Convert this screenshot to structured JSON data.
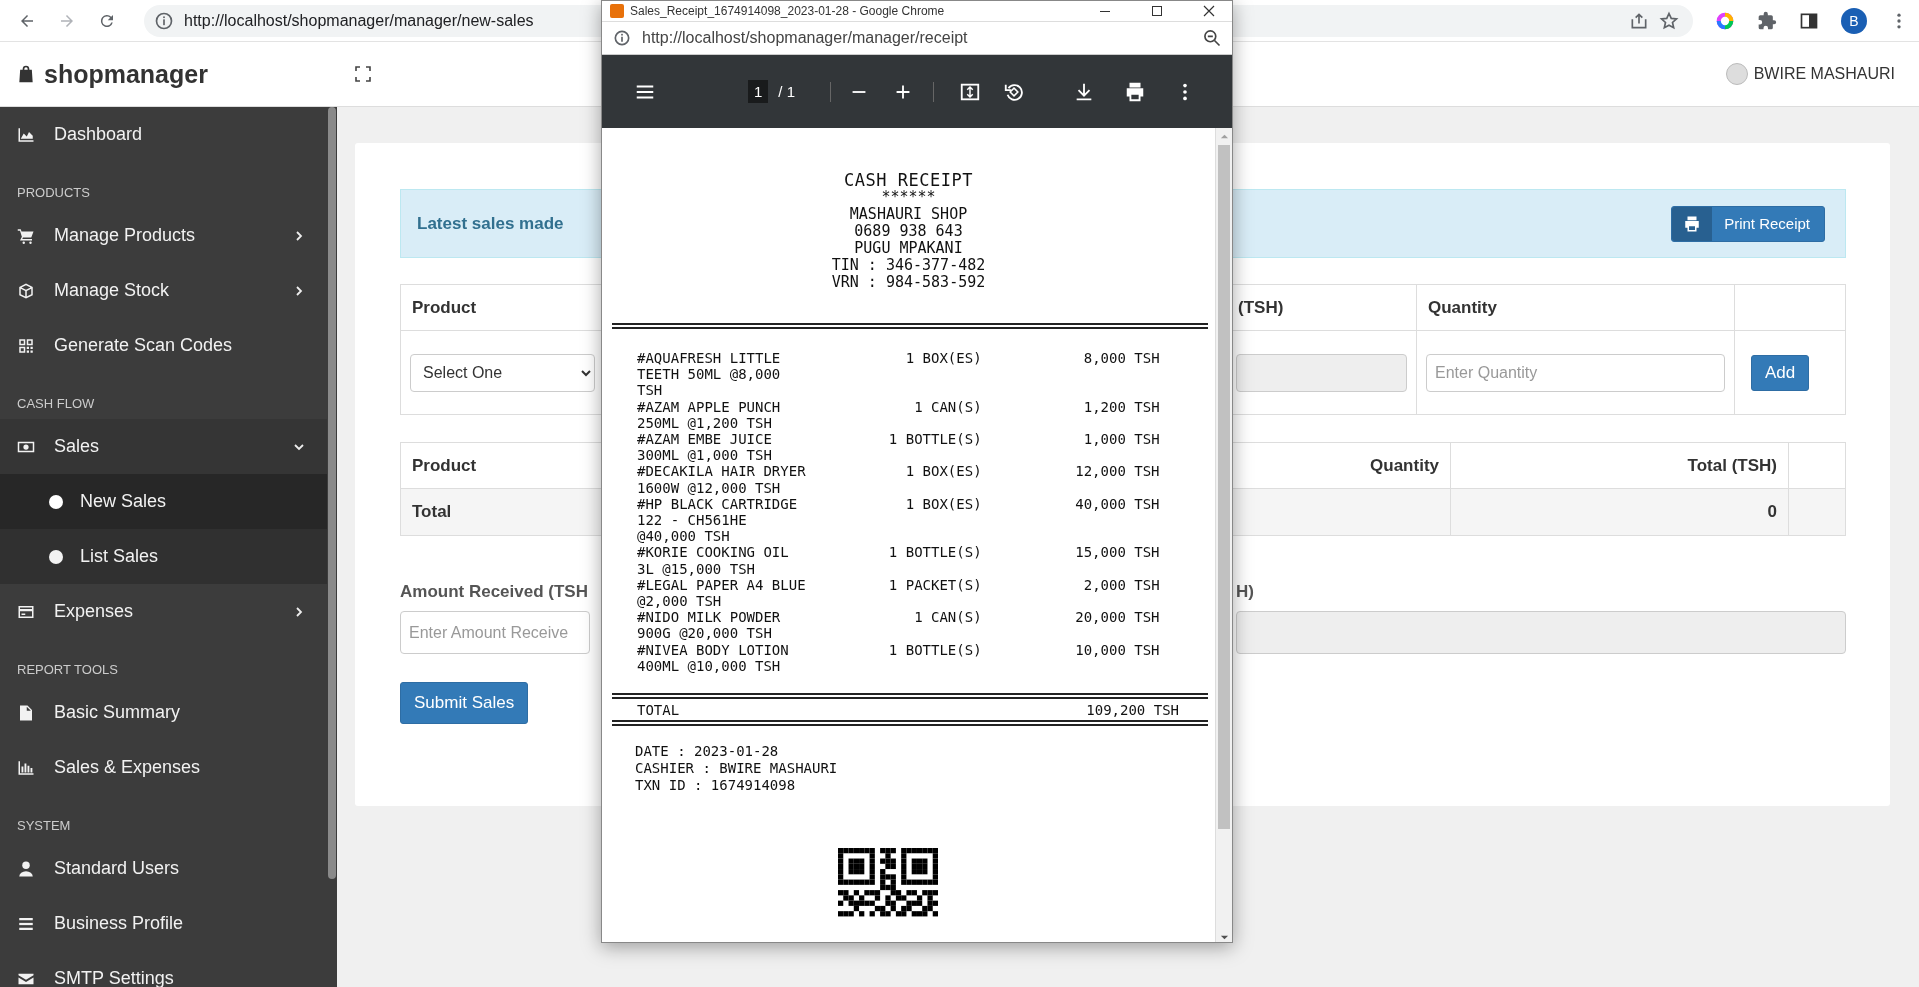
{
  "browser": {
    "url": "http://localhost/shopmanager/manager/new-sales",
    "profile_initial": "B"
  },
  "app_header": {
    "brand": "shopmanager",
    "user": "BWIRE MASHAURI"
  },
  "sidebar": {
    "groups": [
      {
        "items": [
          {
            "label": "Dashboard",
            "selected": false
          }
        ]
      },
      {
        "heading": "PRODUCTS",
        "items": [
          {
            "label": "Manage Products",
            "selected": false,
            "expanded": false
          },
          {
            "label": "Manage Stock",
            "selected": false,
            "expanded": false
          },
          {
            "label": "Generate Scan Codes",
            "selected": false
          }
        ]
      },
      {
        "heading": "CASH FLOW",
        "items": [
          {
            "label": "Sales",
            "selected": false,
            "expanded": true,
            "children": [
              {
                "label": "New Sales",
                "selected": true
              },
              {
                "label": "List Sales",
                "selected": false
              }
            ]
          },
          {
            "label": "Expenses",
            "selected": false,
            "expanded": false
          }
        ]
      },
      {
        "heading": "REPORT TOOLS",
        "items": [
          {
            "label": "Basic Summary",
            "selected": false
          },
          {
            "label": "Sales & Expenses",
            "selected": false
          }
        ]
      },
      {
        "heading": "SYSTEM",
        "items": [
          {
            "label": "Standard Users",
            "selected": false
          },
          {
            "label": "Business Profile",
            "selected": false
          },
          {
            "label": "SMTP Settings",
            "selected": false
          }
        ]
      }
    ]
  },
  "sales_form": {
    "alert": {
      "text": "Latest sales made",
      "button": "Print Receipt"
    },
    "entry_table": {
      "columns": [
        "Product",
        "(TSH)",
        "Quantity"
      ],
      "product_select": {
        "value": "Select One"
      },
      "price_field": {
        "disabled": true
      },
      "quantity_field": {
        "placeholder": "Enter Quantity"
      },
      "add_button": "Add"
    },
    "sales_table": {
      "columns": [
        "Product",
        "Quantity",
        "Total (TSH)"
      ],
      "total_row": {
        "label": "Total",
        "total": "0"
      }
    },
    "amount_received": {
      "label": "Amount Received (TSH",
      "placeholder": "Enter Amount Receive"
    },
    "change": {
      "label": "H)",
      "disabled": true
    },
    "submit_button": "Submit Sales"
  },
  "receipt_window": {
    "title": "Sales_Receipt_1674914098_2023-01-28 - Google Chrome",
    "url": "http://localhost/shopmanager/manager/receipt",
    "pdf_toolbar": {
      "page": "1",
      "page_count": "/ 1"
    },
    "receipt": {
      "title": "CASH RECEIPT",
      "title_mark": "******",
      "header_lines": [
        "MASHAURI SHOP",
        "0689 938 643",
        "PUGU MPAKANI",
        "TIN : 346-377-482",
        "VRN : 984-583-592"
      ],
      "items": [
        {
          "description": "#AQUAFRESH LITTLE TEETH 50ML @8,000 TSH",
          "quantity": "1 BOX(ES)",
          "amount": "8,000 TSH"
        },
        {
          "description": "#AZAM APPLE PUNCH 250ML @1,200 TSH",
          "quantity": "1 CAN(S)",
          "amount": "1,200 TSH"
        },
        {
          "description": "#AZAM EMBE JUICE 300ML @1,000 TSH",
          "quantity": "1 BOTTLE(S)",
          "amount": "1,000 TSH"
        },
        {
          "description": "#DECAKILA HAIR DRYER 1600W @12,000 TSH",
          "quantity": "1 BOX(ES)",
          "amount": "12,000 TSH"
        },
        {
          "description": "#HP BLACK CARTRIDGE 122 - CH561HE @40,000 TSH",
          "quantity": "1 BOX(ES)",
          "amount": "40,000 TSH"
        },
        {
          "description": "#KORIE COOKING OIL 3L @15,000 TSH",
          "quantity": "1 BOTTLE(S)",
          "amount": "15,000 TSH"
        },
        {
          "description": "#LEGAL PAPER A4 BLUE @2,000 TSH",
          "quantity": "1 PACKET(S)",
          "amount": "2,000 TSH"
        },
        {
          "description": "#NIDO MILK POWDER 900G @20,000 TSH",
          "quantity": "1 CAN(S)",
          "amount": "20,000 TSH"
        },
        {
          "description": "#NIVEA BODY LOTION 400ML @10,000 TSH",
          "quantity": "1 BOTTLE(S)",
          "amount": "10,000 TSH"
        }
      ],
      "total_label": "TOTAL",
      "total": "109,200 TSH",
      "footer_lines": [
        "DATE : 2023-01-28",
        "CASHIER : BWIRE MASHAURI",
        "TXN ID : 1674914098"
      ]
    }
  }
}
